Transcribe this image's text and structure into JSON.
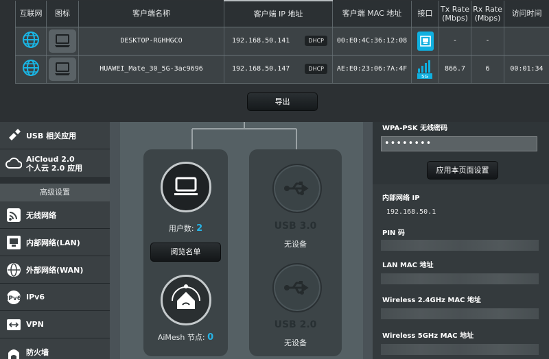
{
  "clients": {
    "headers": [
      "互联网",
      "图标",
      "客户端名称",
      "客户端 IP 地址",
      "客户端 MAC 地址",
      "接口",
      "Tx Rate\n(Mbps)",
      "Rx Rate\n(Mbps)",
      "访问时间"
    ],
    "rows": [
      {
        "name": "DESKTOP-RGHHGCO",
        "ip": "192.168.50.141",
        "ip_type": "DHCP",
        "mac": "00:E0:4C:36:12:08",
        "interface": "lan-icon",
        "tx": "-",
        "rx": "-",
        "time": ""
      },
      {
        "name": "HUAWEI_Mate_30_5G-3ac9696",
        "ip": "192.168.50.147",
        "ip_type": "DHCP",
        "mac": "AE:E0:23:06:7A:4F",
        "interface": "wifi-5g-icon",
        "interface_label": "5G",
        "tx": "866.7",
        "rx": "6",
        "time": "00:01:34"
      }
    ],
    "export_label": "导出"
  },
  "sidebar": {
    "items_top": [
      {
        "label": "USB 相关应用",
        "icon": "usb-apps-icon"
      },
      {
        "label": "AiCloud 2.0\n个人云 2.0 应用",
        "icon": "cloud-icon"
      }
    ],
    "advanced_header": "高级设置",
    "items": [
      {
        "label": "无线网络",
        "icon": "wireless-icon"
      },
      {
        "label": "内部网络(LAN)",
        "icon": "lan-icon"
      },
      {
        "label": "外部网络(WAN)",
        "icon": "globe-icon"
      },
      {
        "label": "IPv6",
        "icon": "ipv6-icon"
      },
      {
        "label": "VPN",
        "icon": "vpn-icon"
      },
      {
        "label": "防火墙",
        "icon": "firewall-icon"
      }
    ]
  },
  "network_map": {
    "clients_label": "用户数:",
    "clients_count": "2",
    "view_list_label": "阅览名单",
    "aimesh_label": "AiMesh 节点:",
    "aimesh_count": "0",
    "usb1_label": "USB 3.0",
    "usb1_status": "无设备",
    "usb2_label": "USB 2.0",
    "usb2_status": "无设备"
  },
  "status_panel": {
    "wpa_label": "WPA-PSK 无线密码",
    "wpa_value": "••••••••",
    "apply_label": "应用本页面设置",
    "lan_ip_label": "内部网络 IP",
    "lan_ip_value": "192.168.50.1",
    "pin_label": "PIN 码",
    "lan_mac_label": "LAN MAC 地址",
    "mac24_label": "Wireless 2.4GHz MAC 地址",
    "mac5_label": "Wireless 5GHz MAC 地址"
  },
  "colors": {
    "accent": "#0fb0e0",
    "count": "#27b4e6"
  }
}
